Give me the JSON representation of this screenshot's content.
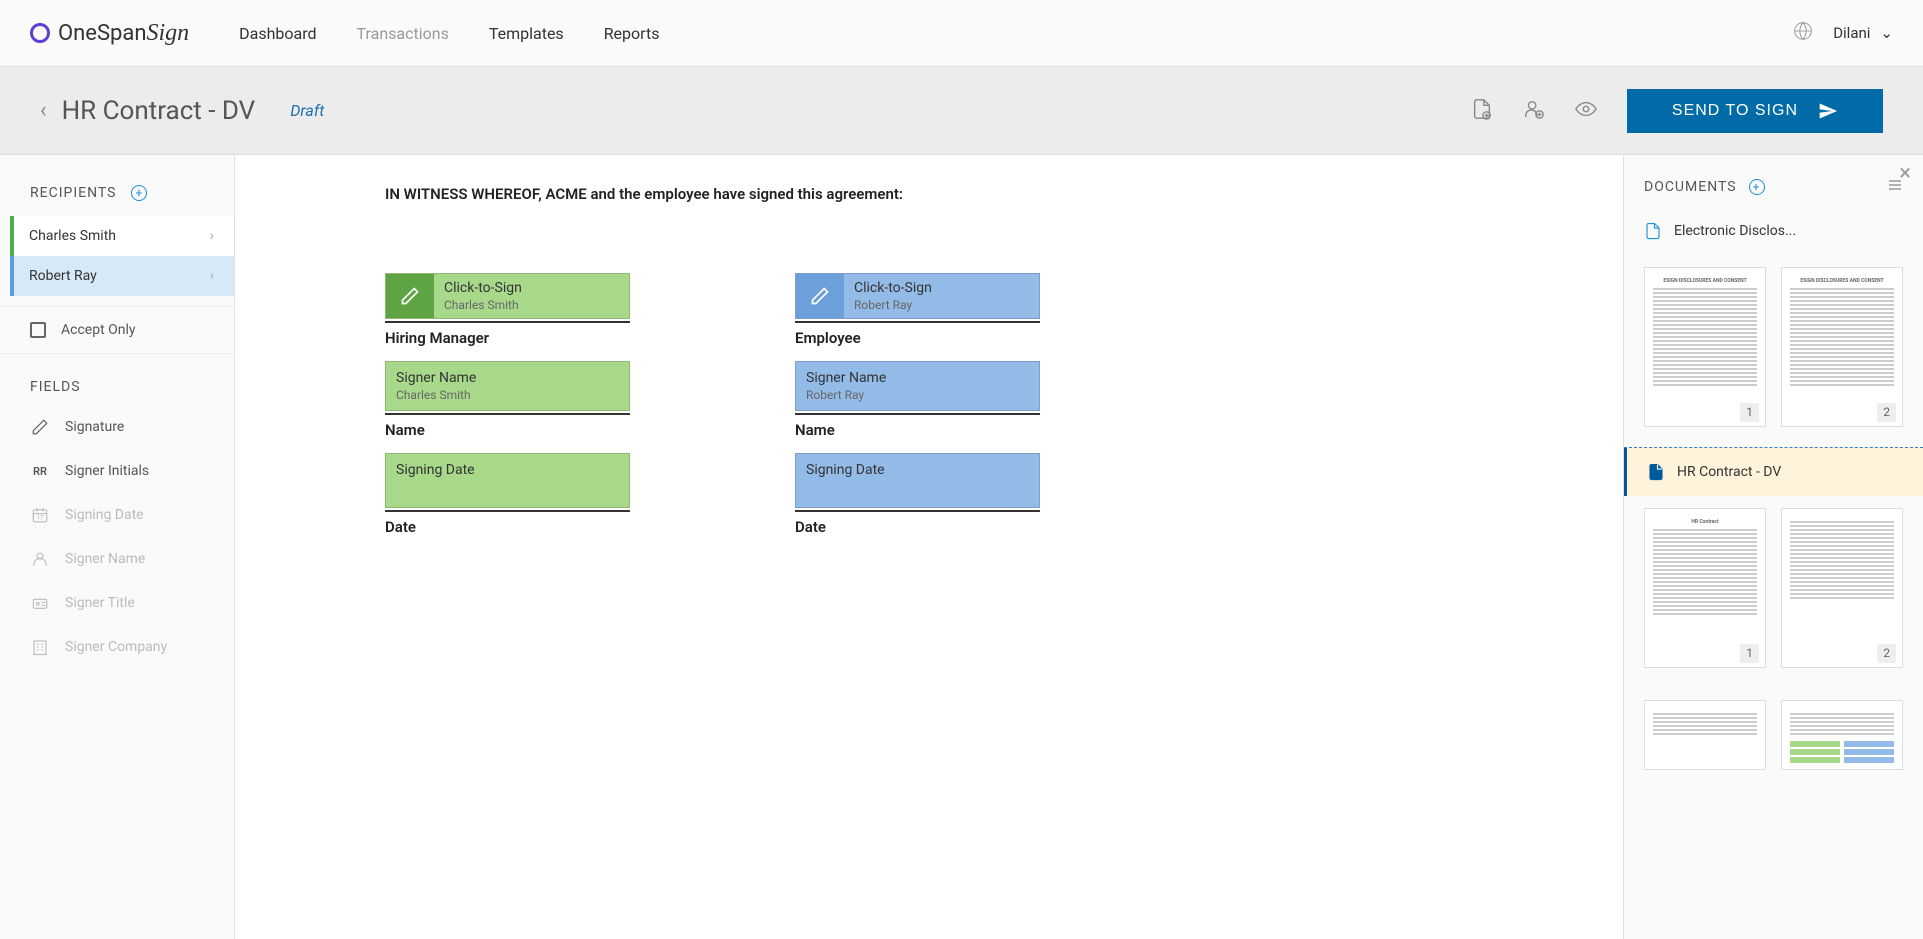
{
  "brand": {
    "name": "OneSpan",
    "suffix": "Sign"
  },
  "nav": {
    "dashboard": "Dashboard",
    "transactions": "Transactions",
    "templates": "Templates",
    "reports": "Reports"
  },
  "user": {
    "name": "Dilani"
  },
  "page": {
    "title": "HR Contract - DV",
    "status": "Draft"
  },
  "actions": {
    "send": "SEND TO SIGN"
  },
  "leftPanel": {
    "recipientsHeader": "RECIPIENTS",
    "recipients": [
      {
        "name": "Charles Smith",
        "color": "green"
      },
      {
        "name": "Robert Ray",
        "color": "blue"
      }
    ],
    "acceptOnly": "Accept Only",
    "fieldsHeader": "FIELDS",
    "fields": [
      {
        "label": "Signature",
        "icon": "pen",
        "disabled": false
      },
      {
        "label": "Signer Initials",
        "icon": "initials",
        "initials": "RR",
        "disabled": false
      },
      {
        "label": "Signing Date",
        "icon": "calendar",
        "disabled": true
      },
      {
        "label": "Signer Name",
        "icon": "person",
        "disabled": true
      },
      {
        "label": "Signer Title",
        "icon": "badge",
        "disabled": true
      },
      {
        "label": "Signer Company",
        "icon": "building",
        "disabled": true
      }
    ]
  },
  "document": {
    "witnessText": "IN WITNESS WHEREOF, ACME and the employee have signed this agreement:",
    "columns": [
      {
        "color": "green",
        "clickLabel": "Click-to-Sign",
        "signer": "Charles Smith",
        "role": "Hiring Manager",
        "nameFieldLabel": "Signer Name",
        "nameValue": "Charles Smith",
        "nameCaption": "Name",
        "dateFieldLabel": "Signing Date",
        "dateCaption": "Date"
      },
      {
        "color": "blue",
        "clickLabel": "Click-to-Sign",
        "signer": "Robert Ray",
        "role": "Employee",
        "nameFieldLabel": "Signer Name",
        "nameValue": "Robert Ray",
        "nameCaption": "Name",
        "dateFieldLabel": "Signing Date",
        "dateCaption": "Date"
      }
    ]
  },
  "rightPanel": {
    "header": "DOCUMENTS",
    "docs": [
      {
        "name": "Electronic Disclos...",
        "active": false,
        "pages": [
          "1",
          "2"
        ]
      },
      {
        "name": "HR Contract - DV",
        "active": true,
        "pages": [
          "1",
          "2"
        ]
      }
    ]
  }
}
